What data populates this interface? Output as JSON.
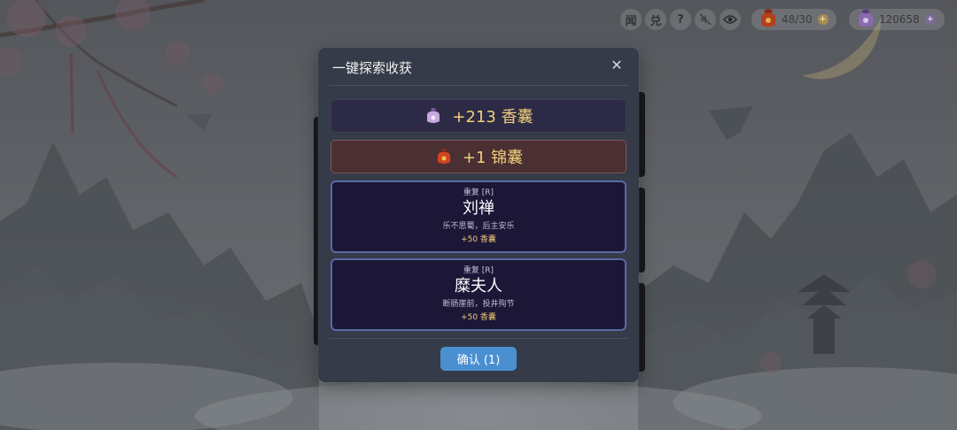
{
  "hud": {
    "mail_label": "闻",
    "redeem_label": "兑",
    "help_label": "?",
    "pouch_count": "48/30",
    "currency_amount": "120658",
    "pouch_plus": "+",
    "currency_plus": "+"
  },
  "modal": {
    "title": "一键探索收获",
    "close_symbol": "✕",
    "rewards": [
      {
        "text": "+213 香囊",
        "icon": "purple-pouch-icon"
      },
      {
        "text": "+1 锦囊",
        "icon": "red-brocade-bag-icon"
      }
    ],
    "cards": [
      {
        "tag": "重复 [R]",
        "name": "刘禅",
        "desc": "乐不思蜀，后主安乐",
        "gain": "+50 香囊"
      },
      {
        "tag": "重复 [R]",
        "name": "糜夫人",
        "desc": "断肠崖前，投井殉节",
        "gain": "+50 香囊"
      }
    ],
    "confirm_label": "确认 (1)"
  },
  "colors": {
    "modal_bg": "#353b48",
    "gold_text": "#f1cf7a",
    "card_border": "#5a6aa6",
    "confirm_bg": "#4a90d0"
  }
}
